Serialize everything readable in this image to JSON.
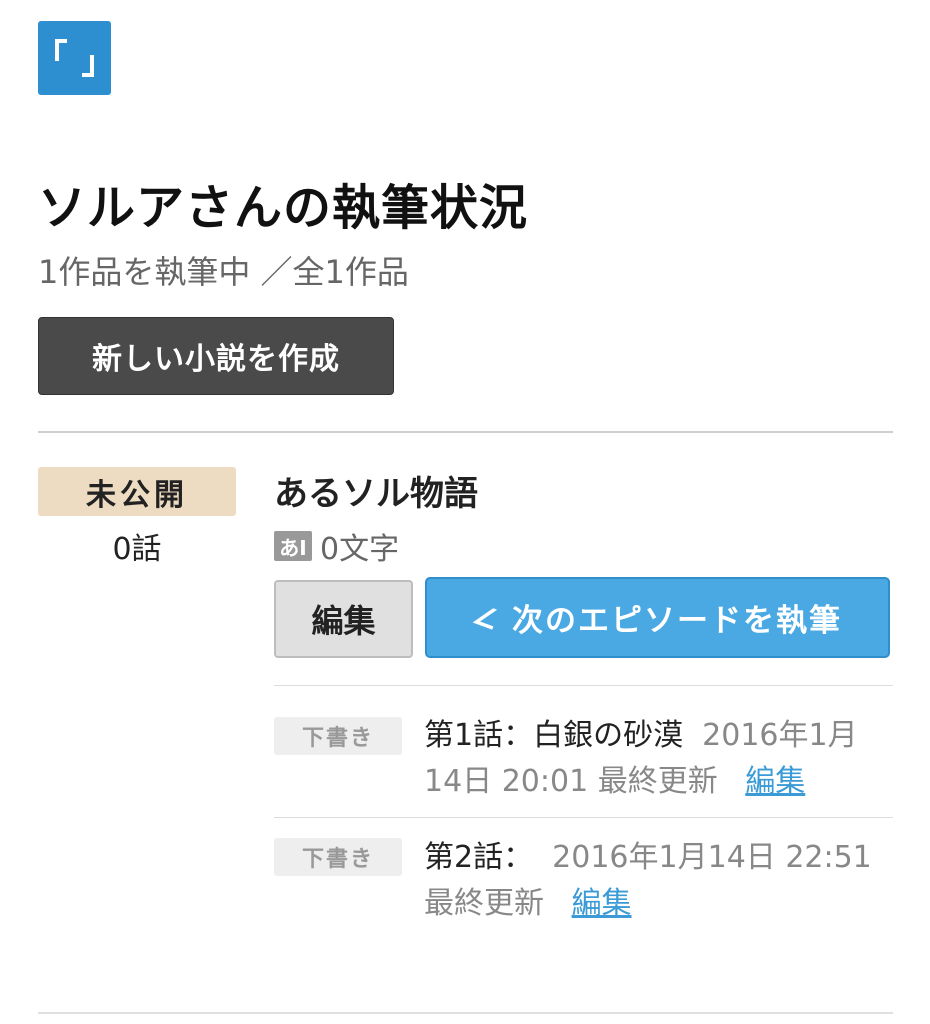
{
  "logo": {
    "icon": "kakuyomu-bracket-logo",
    "color": "#2d8fd0"
  },
  "page": {
    "title": "ソルアさんの執筆状況",
    "summary": "1作品を執筆中 ／全1作品",
    "new_novel_button": "新しい小説を作成"
  },
  "work": {
    "status": "未公開",
    "episode_count": "0話",
    "title": "あるソル物語",
    "char_icon_text": "あI",
    "char_count": "0文字",
    "edit_button": "編集",
    "write_next_button": "次のエピソードを執筆",
    "episodes": [
      {
        "badge": "下書き",
        "title": "第1話：白銀の砂漠",
        "updated": "2016年1月14日 20:01",
        "updated_label": "最終更新",
        "edit_link": "編集"
      },
      {
        "badge": "下書き",
        "title": "第2話：",
        "updated": "2016年1月14日 22:51",
        "updated_label": "最終更新",
        "edit_link": "編集"
      }
    ]
  },
  "colors": {
    "accent": "#4aa9e3",
    "status_badge_bg": "#eedcc2",
    "dark_button": "#4a4a4a",
    "link": "#3a9bd6"
  }
}
